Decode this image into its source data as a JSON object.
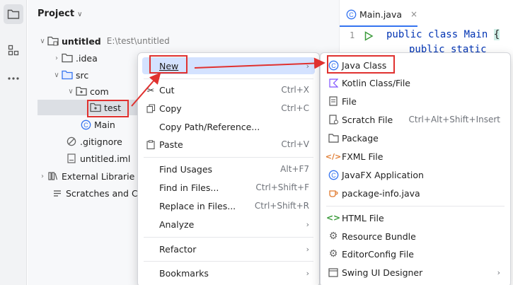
{
  "panel": {
    "title": "Project"
  },
  "tree": {
    "root_name": "untitled",
    "root_path": "E:\\test\\untitled",
    "idea": ".idea",
    "src": "src",
    "com": "com",
    "test": "test",
    "main": "Main",
    "gitignore": ".gitignore",
    "iml": "untitled.iml",
    "external": "External Librarie",
    "scratches": "Scratches and Co"
  },
  "editor": {
    "tab_label": "Main.java",
    "line_number": "1",
    "code_line1_kw": "public class Main ",
    "code_line1_brace": "{",
    "code_line2": "public static void"
  },
  "menu1": {
    "new": "New",
    "cut": "Cut",
    "cut_sc": "Ctrl+X",
    "copy": "Copy",
    "copy_sc": "Ctrl+C",
    "copy_path": "Copy Path/Reference...",
    "paste": "Paste",
    "paste_sc": "Ctrl+V",
    "find_usages": "Find Usages",
    "find_usages_sc": "Alt+F7",
    "find_in_files": "Find in Files...",
    "find_in_files_sc": "Ctrl+Shift+F",
    "replace_in_files": "Replace in Files...",
    "replace_in_files_sc": "Ctrl+Shift+R",
    "analyze": "Analyze",
    "refactor": "Refactor",
    "bookmarks": "Bookmarks"
  },
  "menu2": {
    "java_class": "Java Class",
    "kotlin": "Kotlin Class/File",
    "file": "File",
    "scratch": "Scratch File",
    "scratch_sc": "Ctrl+Alt+Shift+Insert",
    "package": "Package",
    "fxml": "FXML File",
    "javafx": "JavaFX Application",
    "package_info": "package-info.java",
    "html": "HTML File",
    "resource_bundle": "Resource Bundle",
    "editorconfig": "EditorConfig File",
    "swing": "Swing UI Designer"
  },
  "colors": {
    "accent": "#3574f0",
    "annotation_red": "#e0312f",
    "menu_highlight": "#d4e2ff"
  }
}
